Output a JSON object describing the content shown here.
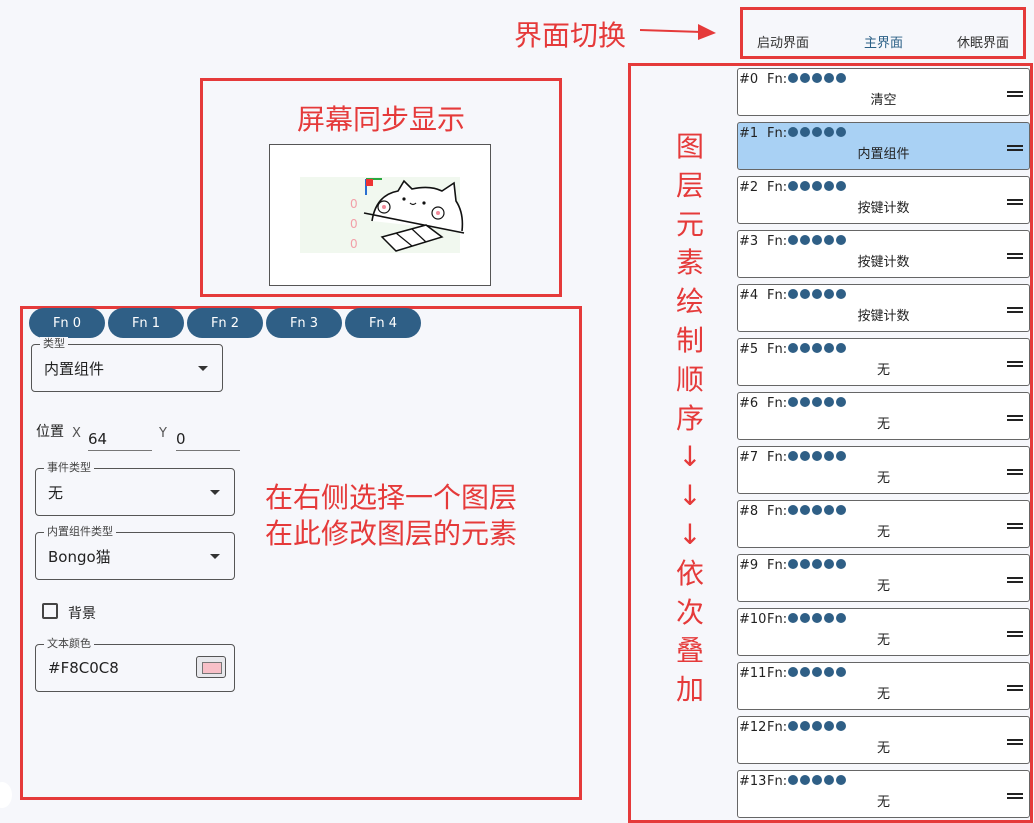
{
  "annotations": {
    "interface_switch": "界面切换",
    "screen_sync": "屏幕同步显示",
    "layer_order_chars": [
      "图",
      "层",
      "元",
      "素",
      "绘",
      "制",
      "顺",
      "序",
      "↓",
      "↓",
      "↓",
      "依",
      "次",
      "叠",
      "加"
    ],
    "hint_line1": "在右侧选择一个图层",
    "hint_line2": "在此修改图层的元素"
  },
  "tabs": [
    {
      "label": "启动界面",
      "active": false
    },
    {
      "label": "主界面",
      "active": true
    },
    {
      "label": "休眠界面",
      "active": false
    }
  ],
  "fn_tabs": [
    "Fn 0",
    "Fn 1",
    "Fn 2",
    "Fn 3",
    "Fn 4"
  ],
  "editor": {
    "type_label": "类型",
    "type_value": "内置组件",
    "position_label": "位置",
    "x_label": "X",
    "x_value": "64",
    "y_label": "Y",
    "y_value": "0",
    "event_type_label": "事件类型",
    "event_type_value": "无",
    "builtin_type_label": "内置组件类型",
    "builtin_type_value": "Bongo猫",
    "background_label": "背景",
    "text_color_label": "文本颜色",
    "text_color_value": "#F8C0C8"
  },
  "preview": {
    "counters": [
      "0",
      "0",
      "0"
    ]
  },
  "layers": [
    {
      "index": "#0",
      "fn": "Fn:",
      "type": "清空",
      "selected": false
    },
    {
      "index": "#1",
      "fn": "Fn:",
      "type": "内置组件",
      "selected": true
    },
    {
      "index": "#2",
      "fn": "Fn:",
      "type": "按键计数",
      "selected": false
    },
    {
      "index": "#3",
      "fn": "Fn:",
      "type": "按键计数",
      "selected": false
    },
    {
      "index": "#4",
      "fn": "Fn:",
      "type": "按键计数",
      "selected": false
    },
    {
      "index": "#5",
      "fn": "Fn:",
      "type": "无",
      "selected": false
    },
    {
      "index": "#6",
      "fn": "Fn:",
      "type": "无",
      "selected": false
    },
    {
      "index": "#7",
      "fn": "Fn:",
      "type": "无",
      "selected": false
    },
    {
      "index": "#8",
      "fn": "Fn:",
      "type": "无",
      "selected": false
    },
    {
      "index": "#9",
      "fn": "Fn:",
      "type": "无",
      "selected": false
    },
    {
      "index": "#10",
      "fn": "Fn:",
      "type": "无",
      "selected": false
    },
    {
      "index": "#11",
      "fn": "Fn:",
      "type": "无",
      "selected": false
    },
    {
      "index": "#12",
      "fn": "Fn:",
      "type": "无",
      "selected": false
    },
    {
      "index": "#13",
      "fn": "Fn:",
      "type": "无",
      "selected": false
    }
  ],
  "colors": {
    "accent": "#2f5f86",
    "annotation_red": "#e53a3a",
    "selected_row": "#a9d1f4",
    "swatch": "#F8C0C8"
  }
}
